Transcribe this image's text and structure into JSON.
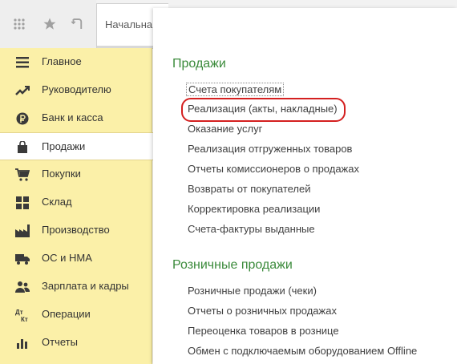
{
  "topbar": {
    "icons": [
      "apps-grid-icon",
      "star-icon",
      "history-icon"
    ],
    "home_tab_label": "Начальна"
  },
  "sidebar": {
    "items": [
      {
        "label": "Главное",
        "icon": "menu-lines-icon"
      },
      {
        "label": "Руководителю",
        "icon": "trend-chart-icon"
      },
      {
        "label": "Банк и касса",
        "icon": "ruble-coin-icon"
      },
      {
        "label": "Продажи",
        "icon": "shopping-bag-icon",
        "active": true
      },
      {
        "label": "Покупки",
        "icon": "shopping-cart-icon"
      },
      {
        "label": "Склад",
        "icon": "warehouse-grid-icon"
      },
      {
        "label": "Производство",
        "icon": "factory-icon"
      },
      {
        "label": "ОС и НМА",
        "icon": "truck-icon"
      },
      {
        "label": "Зарплата и кадры",
        "icon": "people-icon"
      },
      {
        "label": "Операции",
        "icon": "dt-kt-icon"
      },
      {
        "label": "Отчеты",
        "icon": "bar-chart-icon"
      }
    ]
  },
  "content": {
    "sections": [
      {
        "title": "Продажи",
        "links": [
          "Счета покупателям",
          "Реализация (акты, накладные)",
          "Оказание услуг",
          "Реализация отгруженных товаров",
          "Отчеты комиссионеров о продажах",
          "Возвраты от покупателей",
          "Корректировка реализации",
          "Счета-фактуры выданные"
        ]
      },
      {
        "title": "Розничные продажи",
        "links": [
          "Розничные продажи (чеки)",
          "Отчеты о розничных продажах",
          "Переоценка товаров в рознице",
          "Обмен с подключаемым оборудованием Offline"
        ]
      }
    ]
  },
  "colors": {
    "sidebar_bg": "#fbf0a8",
    "section_title": "#3a8a3a",
    "highlight": "#d42020"
  }
}
